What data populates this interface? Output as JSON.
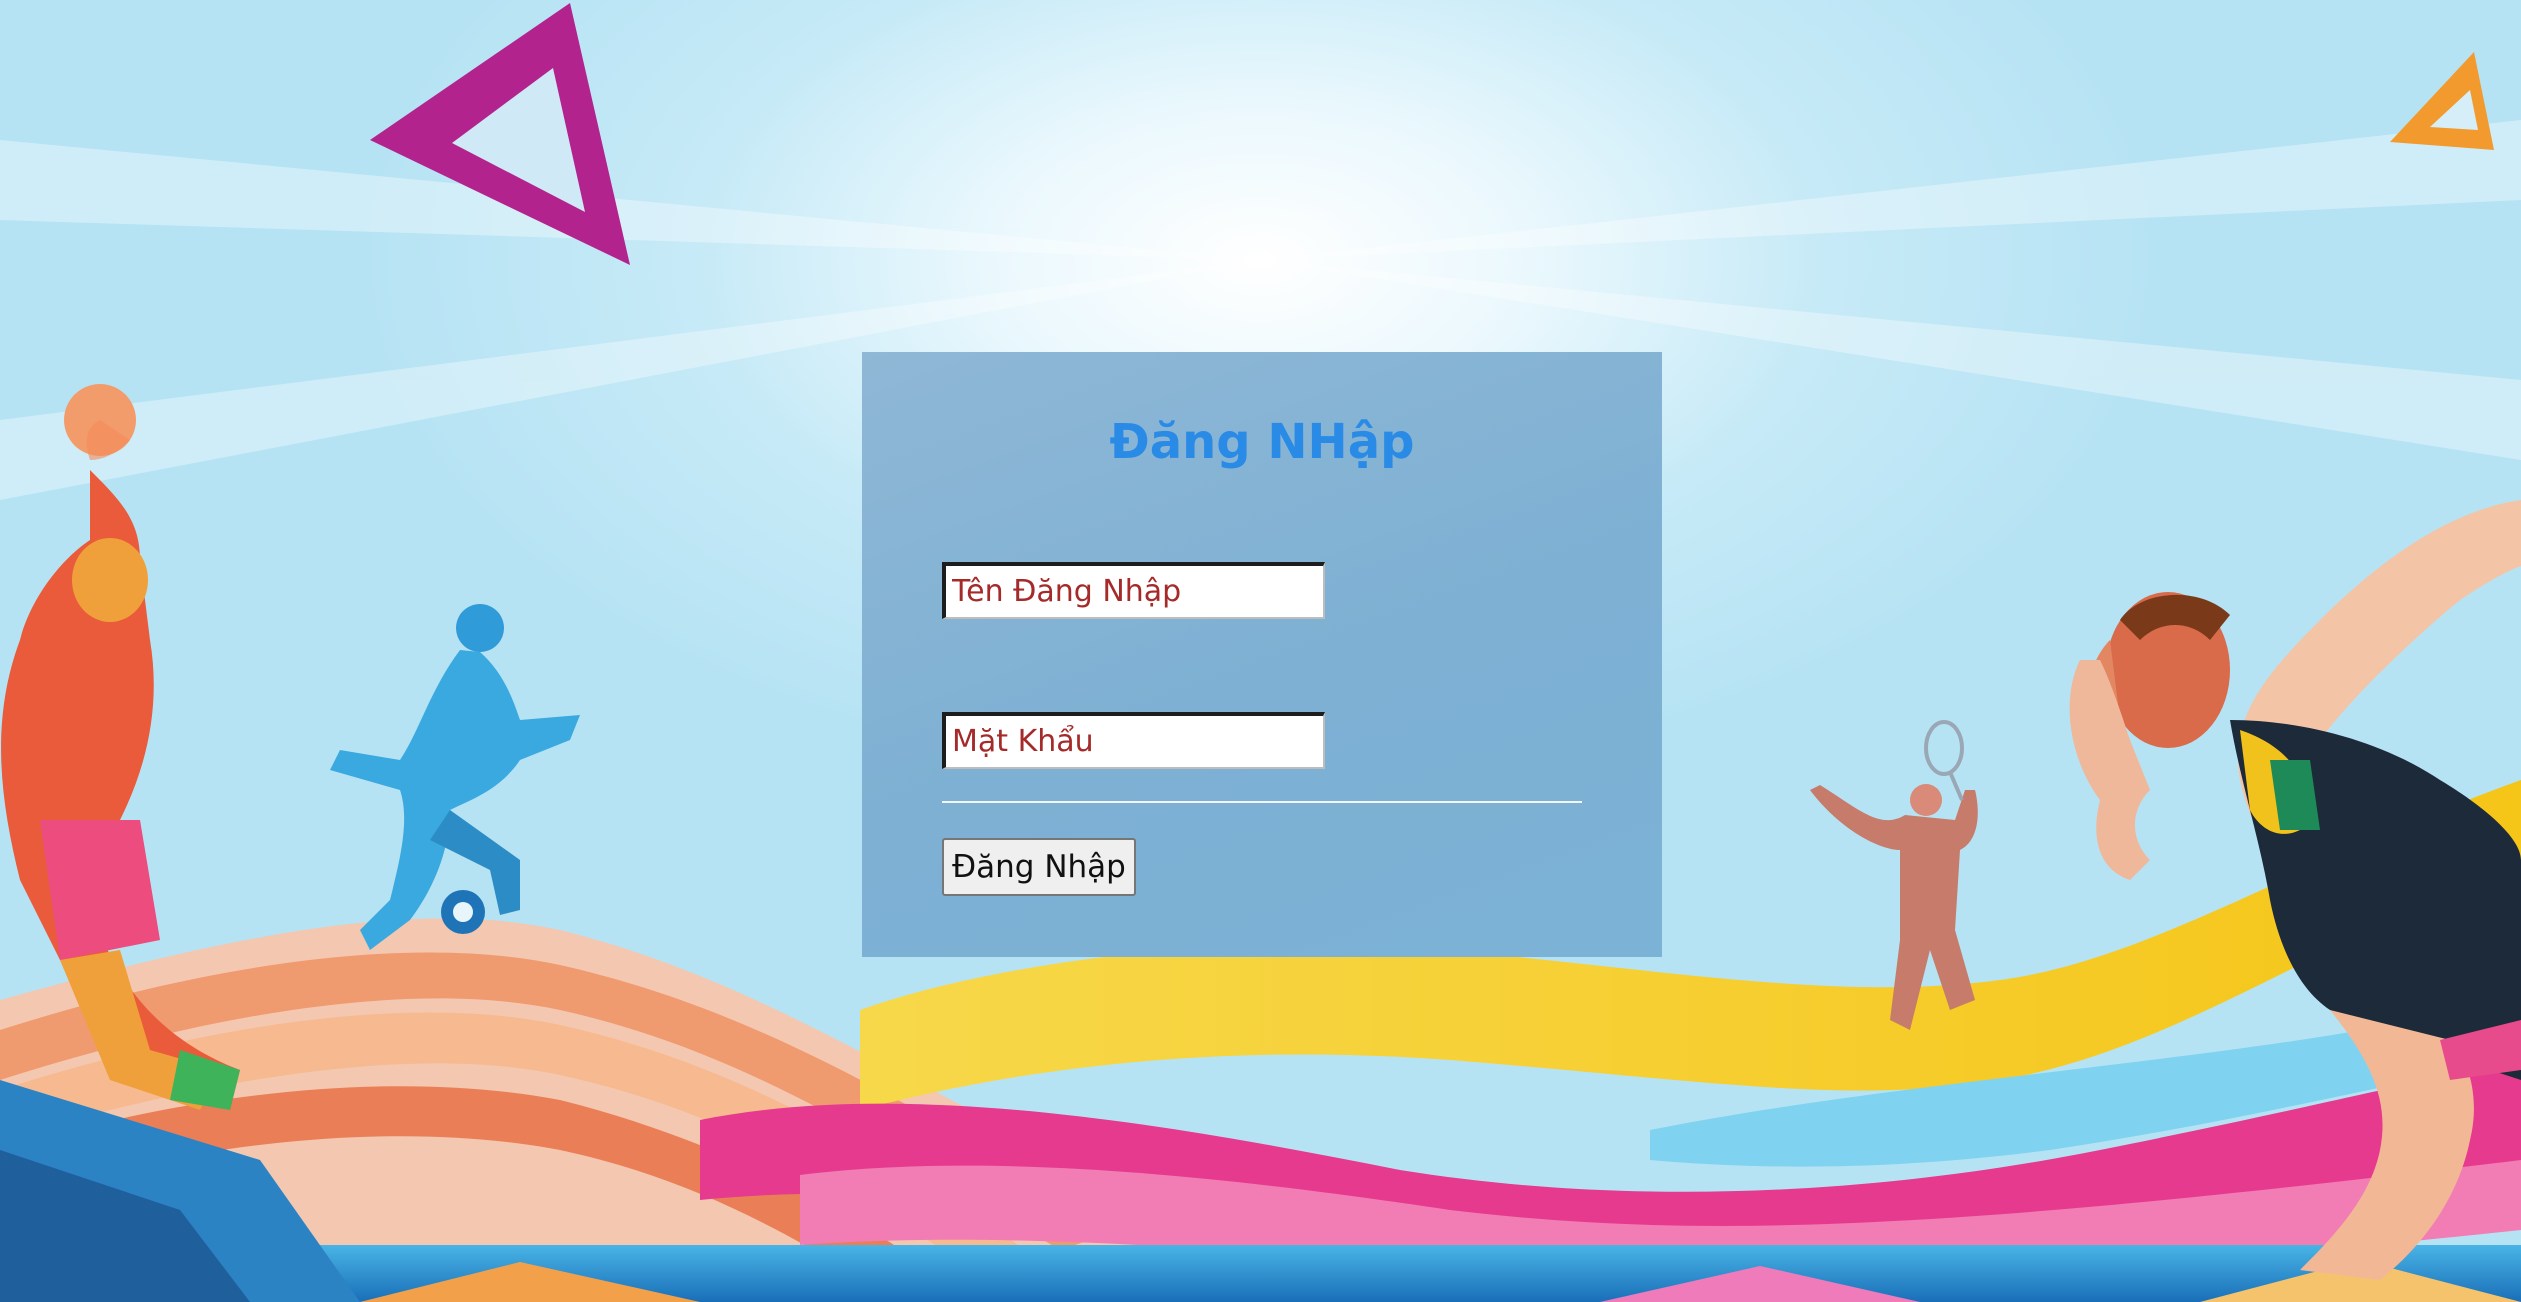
{
  "login": {
    "title": "Đăng NHập",
    "username_placeholder": "Tên Đăng Nhập",
    "password_placeholder": "Mặt Khẩu",
    "submit_label": "Đăng Nhập"
  },
  "colors": {
    "panel_background": "#7fb1d3",
    "title_color": "#2a8be6",
    "placeholder_color": "#a52a2a",
    "button_background": "#efefef"
  }
}
